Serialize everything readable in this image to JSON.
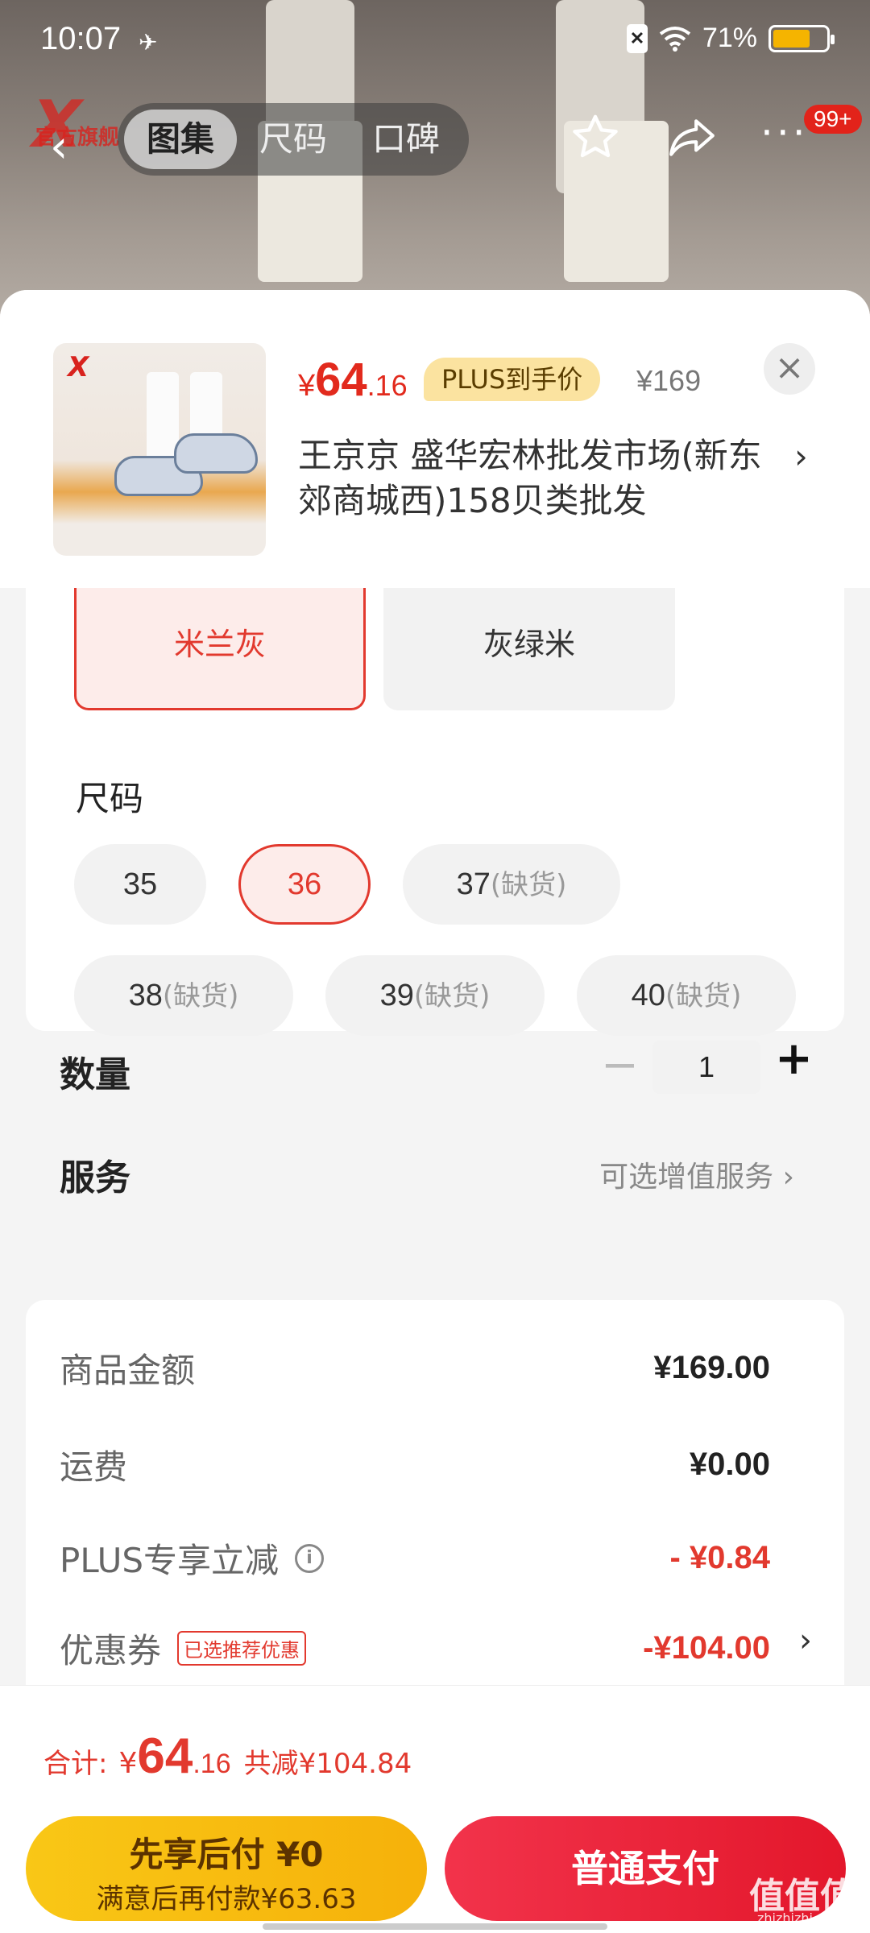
{
  "status_bar": {
    "time": "10:07",
    "battery": "71%",
    "battery_level": 0.71
  },
  "top_bar": {
    "brand_mark": "X",
    "brand_text": "官方旗舰",
    "tabs": [
      {
        "label": "图集"
      },
      {
        "label": "尺码"
      },
      {
        "label": "口碑"
      }
    ],
    "cart_badge": "99+"
  },
  "product": {
    "price_currency": "¥",
    "price_int": "64",
    "price_dec": ".16",
    "plus_label": "PLUS到手价",
    "original_price": "¥169",
    "address": "王京京  盛华宏林批发市场(新东郊商城西)158贝类批发",
    "thumb_brand": "X"
  },
  "colors": [
    {
      "label": "米兰灰",
      "selected": true
    },
    {
      "label": "灰绿米",
      "selected": false
    }
  ],
  "size_section": {
    "title": "尺码",
    "out_of_stock": "(缺货)",
    "sizes": [
      {
        "label": "35"
      },
      {
        "label": "36"
      },
      {
        "label": "37"
      },
      {
        "label": "38"
      },
      {
        "label": "39"
      },
      {
        "label": "40"
      }
    ]
  },
  "quantity": {
    "label": "数量",
    "value": "1",
    "minus": "−",
    "plus": "+"
  },
  "service": {
    "label": "服务",
    "value": "可选增值服务"
  },
  "summary": {
    "goods_label": "商品金额",
    "goods_value": "¥169.00",
    "shipping_label": "运费",
    "shipping_value": "¥0.00",
    "plus_label": "PLUS专享立减",
    "plus_value": "- ¥0.84",
    "coupon_label": "优惠券",
    "coupon_tag": "已选推荐优惠",
    "coupon_value": "-¥104.00"
  },
  "footer": {
    "total_label": "合计:",
    "total_currency": "¥",
    "total_int": "64",
    "total_dec": ".16",
    "saved": "共减¥104.84",
    "later_title": "先享后付 ¥0",
    "later_sub": "满意后再付款¥63.63",
    "pay_label": "普通支付"
  },
  "watermark": {
    "main": "值值值",
    "sub": "zhizhizhi.com"
  }
}
